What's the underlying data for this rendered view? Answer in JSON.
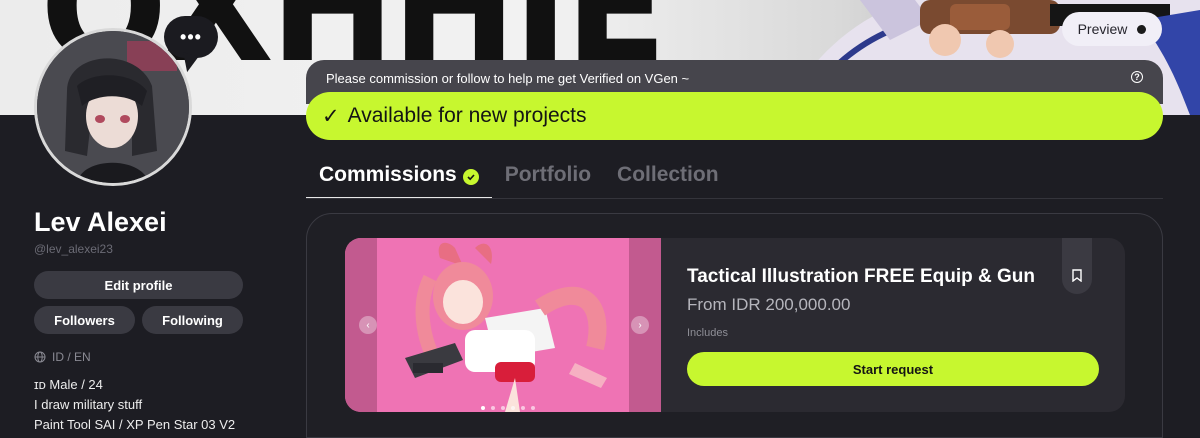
{
  "banner": {
    "word": "OXHHIE"
  },
  "header": {
    "preview_label": "Preview"
  },
  "profile": {
    "more_label": "•••",
    "name": "Lev Alexei",
    "handle": "@lev_alexei23",
    "edit_label": "Edit profile",
    "followers_label": "Followers",
    "following_label": "Following",
    "languages": "ID / EN",
    "bio": [
      "ɪᴅ Male / 24",
      "I draw military stuff",
      "Paint Tool SAI / XP Pen Star 03 V2"
    ]
  },
  "notice": {
    "text": "Please commission or follow to help me get Verified on VGen ~",
    "help_symbol": "?"
  },
  "status": {
    "check": "✓",
    "text": "Available for new projects"
  },
  "tabs": [
    {
      "label": "Commissions"
    },
    {
      "label": "Portfolio"
    },
    {
      "label": "Collection"
    }
  ],
  "card": {
    "title": "Tactical Illustration FREE Equip & Gun",
    "price": "From IDR 200,000.00",
    "includes_label": "Includes",
    "cta_label": "Start request",
    "prev_symbol": "‹",
    "next_symbol": "›"
  },
  "colors": {
    "accent": "#c7f72f",
    "background": "#1d1d23",
    "card": "#2b2a31",
    "image_bg": "#ef73b4"
  }
}
